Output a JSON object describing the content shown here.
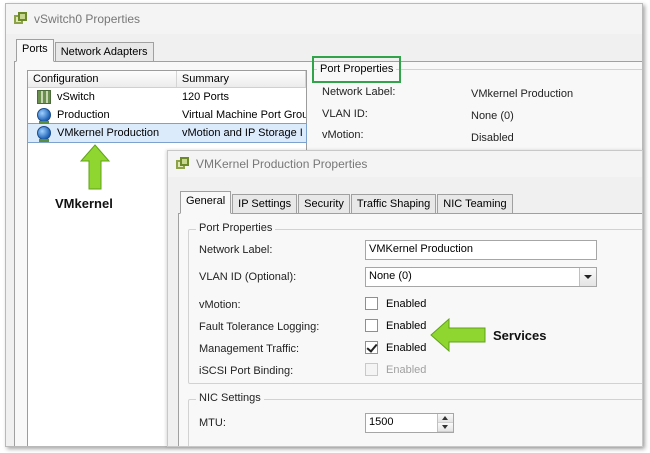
{
  "main_window": {
    "title": "vSwitch0 Properties",
    "tabs": [
      {
        "label": "Ports",
        "active": true
      },
      {
        "label": "Network Adapters",
        "active": false
      }
    ],
    "list": {
      "columns": [
        "Configuration",
        "Summary"
      ],
      "rows": [
        {
          "icon": "switch-icon",
          "configuration": "vSwitch",
          "summary": "120 Ports",
          "selected": false
        },
        {
          "icon": "globe-icon",
          "configuration": "Production",
          "summary": "Virtual Machine Port Grou",
          "selected": false
        },
        {
          "icon": "globe-icon",
          "configuration": "VMkernel Production",
          "summary": "vMotion and IP Storage I",
          "selected": true
        }
      ]
    },
    "port_properties": {
      "legend": "Port Properties",
      "rows": [
        {
          "label": "Network Label:",
          "value": "VMkernel Production"
        },
        {
          "label": "VLAN ID:",
          "value": "None (0)"
        },
        {
          "label": "vMotion:",
          "value": "Disabled"
        }
      ]
    }
  },
  "annotations": {
    "vmkernel_label": "VMkernel",
    "services_label": "Services",
    "highlight_color": "#31a34a",
    "arrow_color": "#8fd630"
  },
  "dialog": {
    "title": "VMKernel Production Properties",
    "tabs": [
      {
        "label": "General",
        "active": true
      },
      {
        "label": "IP Settings",
        "active": false
      },
      {
        "label": "Security",
        "active": false
      },
      {
        "label": "Traffic Shaping",
        "active": false
      },
      {
        "label": "NIC Teaming",
        "active": false
      }
    ],
    "port_properties": {
      "legend": "Port Properties",
      "network_label": {
        "label": "Network Label:",
        "value": "VMKernel Production"
      },
      "vlan_id": {
        "label": "VLAN ID (Optional):",
        "value": "None (0)"
      },
      "services": [
        {
          "label": "vMotion:",
          "checkbox_label": "Enabled",
          "checked": false,
          "disabled": false
        },
        {
          "label": "Fault Tolerance Logging:",
          "checkbox_label": "Enabled",
          "checked": false,
          "disabled": false
        },
        {
          "label": "Management Traffic:",
          "checkbox_label": "Enabled",
          "checked": true,
          "disabled": false
        },
        {
          "label": "iSCSI Port Binding:",
          "checkbox_label": "Enabled",
          "checked": false,
          "disabled": true
        }
      ]
    },
    "nic_settings": {
      "legend": "NIC Settings",
      "mtu": {
        "label": "MTU:",
        "value": "1500"
      }
    }
  }
}
